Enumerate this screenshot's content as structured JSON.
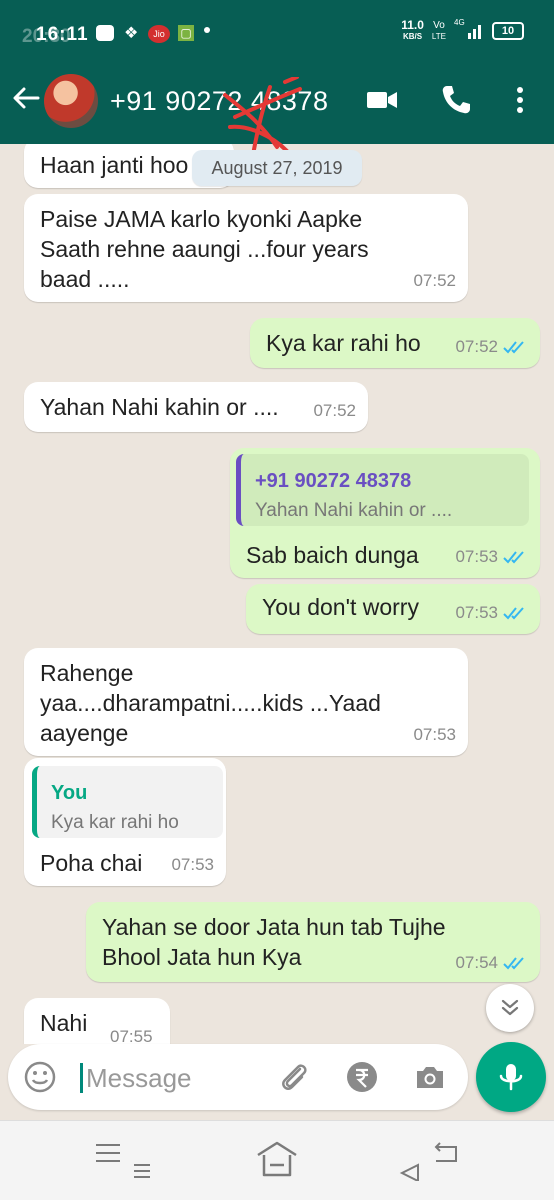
{
  "status_bar": {
    "time": "16:11",
    "ghost_time": "20:30",
    "network_speed": "11.0",
    "network_unit": "KB/S",
    "volte": "Vo",
    "lte": "LTE",
    "signal_label": "4G",
    "battery": "10",
    "jio_label": "Jio"
  },
  "header": {
    "contact_name": "+91 90272 48378",
    "colors": {
      "bar": "#075E54",
      "accent": "#00A884"
    }
  },
  "chat": {
    "date_chip": "August 27, 2019",
    "messages": [
      {
        "dir": "in",
        "text": "Haan janti hoo",
        "time": ""
      },
      {
        "dir": "in",
        "text": "Paise JAMA karlo kyonki Aapke\nSaath rehne aaungi ...four years\nbaad .....",
        "time": "07:52"
      },
      {
        "dir": "out",
        "text": "Kya kar rahi ho",
        "time": "07:52",
        "read": true
      },
      {
        "dir": "in",
        "text": "Yahan Nahi kahin or ....",
        "time": "07:52"
      },
      {
        "dir": "out",
        "quote_name": "+91 90272 48378",
        "quote_text": "Yahan Nahi kahin or ....",
        "text": "Sab baich dunga",
        "time": "07:53",
        "read": true
      },
      {
        "dir": "out",
        "text": "You don't worry",
        "time": "07:53",
        "read": true
      },
      {
        "dir": "in",
        "text": "Rahenge\nyaa....dharampatni.....kids ...Yaad\naayenge",
        "time": "07:53"
      },
      {
        "dir": "in",
        "quote_name": "You",
        "quote_text": "Kya kar rahi ho",
        "text": "Poha chai",
        "time": "07:53"
      },
      {
        "dir": "out",
        "text": "Yahan se door Jata hun tab Tujhe\nBhool Jata hun Kya",
        "time": "07:54",
        "read": true
      },
      {
        "dir": "in",
        "text": "Nahi",
        "time": "07:55"
      }
    ]
  },
  "composer": {
    "placeholder": "Message"
  },
  "icons": {
    "back": "arrow-left",
    "video": "video-camera",
    "call": "phone",
    "menu": "more-vertical",
    "emoji": "smiley",
    "attach": "paperclip",
    "payment": "rupee",
    "camera": "camera",
    "mic": "microphone",
    "scroll": "double-chevron-down"
  }
}
